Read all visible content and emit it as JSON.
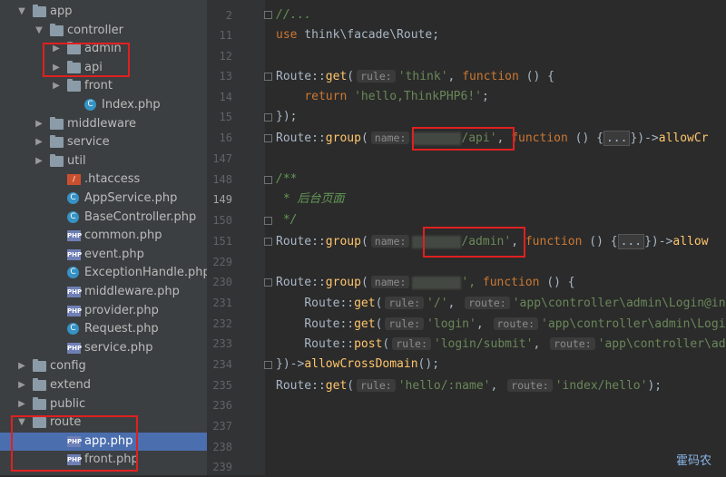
{
  "tree": [
    {
      "label": "app",
      "type": "folder",
      "depth": 0,
      "expanded": true
    },
    {
      "label": "controller",
      "type": "folder",
      "depth": 1,
      "expanded": true
    },
    {
      "label": "admin",
      "type": "folder",
      "depth": 2,
      "expanded": false
    },
    {
      "label": "api",
      "type": "folder",
      "depth": 2,
      "expanded": false
    },
    {
      "label": "front",
      "type": "folder",
      "depth": 2,
      "expanded": false
    },
    {
      "label": "Index.php",
      "type": "class",
      "depth": 3
    },
    {
      "label": "middleware",
      "type": "folder",
      "depth": 1,
      "expanded": false
    },
    {
      "label": "service",
      "type": "folder",
      "depth": 1,
      "expanded": false
    },
    {
      "label": "util",
      "type": "folder",
      "depth": 1,
      "expanded": false
    },
    {
      "label": ".htaccess",
      "type": "git",
      "depth": 2
    },
    {
      "label": "AppService.php",
      "type": "class",
      "depth": 2
    },
    {
      "label": "BaseController.php",
      "type": "class",
      "depth": 2
    },
    {
      "label": "common.php",
      "type": "php",
      "depth": 2
    },
    {
      "label": "event.php",
      "type": "php",
      "depth": 2
    },
    {
      "label": "ExceptionHandle.php",
      "type": "class",
      "depth": 2
    },
    {
      "label": "middleware.php",
      "type": "php",
      "depth": 2
    },
    {
      "label": "provider.php",
      "type": "php",
      "depth": 2
    },
    {
      "label": "Request.php",
      "type": "class",
      "depth": 2
    },
    {
      "label": "service.php",
      "type": "php",
      "depth": 2
    },
    {
      "label": "config",
      "type": "folder",
      "depth": 0,
      "expanded": false
    },
    {
      "label": "extend",
      "type": "folder",
      "depth": 0,
      "expanded": false
    },
    {
      "label": "public",
      "type": "folder",
      "depth": 0,
      "expanded": false
    },
    {
      "label": "route",
      "type": "folder",
      "depth": 0,
      "expanded": true
    },
    {
      "label": "app.php",
      "type": "php",
      "depth": 2,
      "selected": true
    },
    {
      "label": "front.php",
      "type": "php",
      "depth": 2
    }
  ],
  "line_numbers": [
    "2",
    "11",
    "12",
    "13",
    "14",
    "15",
    "16",
    "147",
    "148",
    "149",
    "150",
    "151",
    "229",
    "230",
    "231",
    "232",
    "233",
    "234",
    "235",
    "236",
    "237",
    "238",
    "239"
  ],
  "code": {
    "l1_comment": "//...",
    "l2_use": "use",
    "l2_ns": " think\\facade\\Route;",
    "route": "Route",
    "get": "get",
    "group": "group",
    "post": "post",
    "sep": "::",
    "paren_open": "(",
    "hint_rule": "rule:",
    "hint_name": "name:",
    "hint_route": "route:",
    "think": "'think'",
    "function_kw": "function",
    "fn_open": " () {",
    "return_kw": "return",
    "hello_str": "'hello,ThinkPHP6!'",
    "semi": ";",
    "close": "});",
    "api_str": "/api'",
    "fold_dots": "...",
    "allow": "allowCr",
    "allow2": "allow",
    "allow_full": "allowCrossDomain",
    "doc_open": "/**",
    "doc_cn": " * 后台页面",
    "doc_close": " */",
    "admin_str": "/admin'",
    "quote_comma": "',",
    "slash_str": "'/'",
    "ctrl_admin_login_in": "'app\\controller\\admin\\Login@in",
    "login_str": "'login'",
    "ctrl_admin_logi": "'app\\controller\\admin\\Logi",
    "login_submit": "'login/submit'",
    "ctrl_ad": "'app\\controller\\ad",
    "close_arrow": "})->",
    "allow_end": "();",
    "hello_name": "'hello/:name'",
    "index_hello": "'index/hello'",
    "end": ");"
  },
  "watermark": "霍码农",
  "colors": {
    "highlight_box": "#e02020",
    "selection": "#4b6eaf"
  }
}
